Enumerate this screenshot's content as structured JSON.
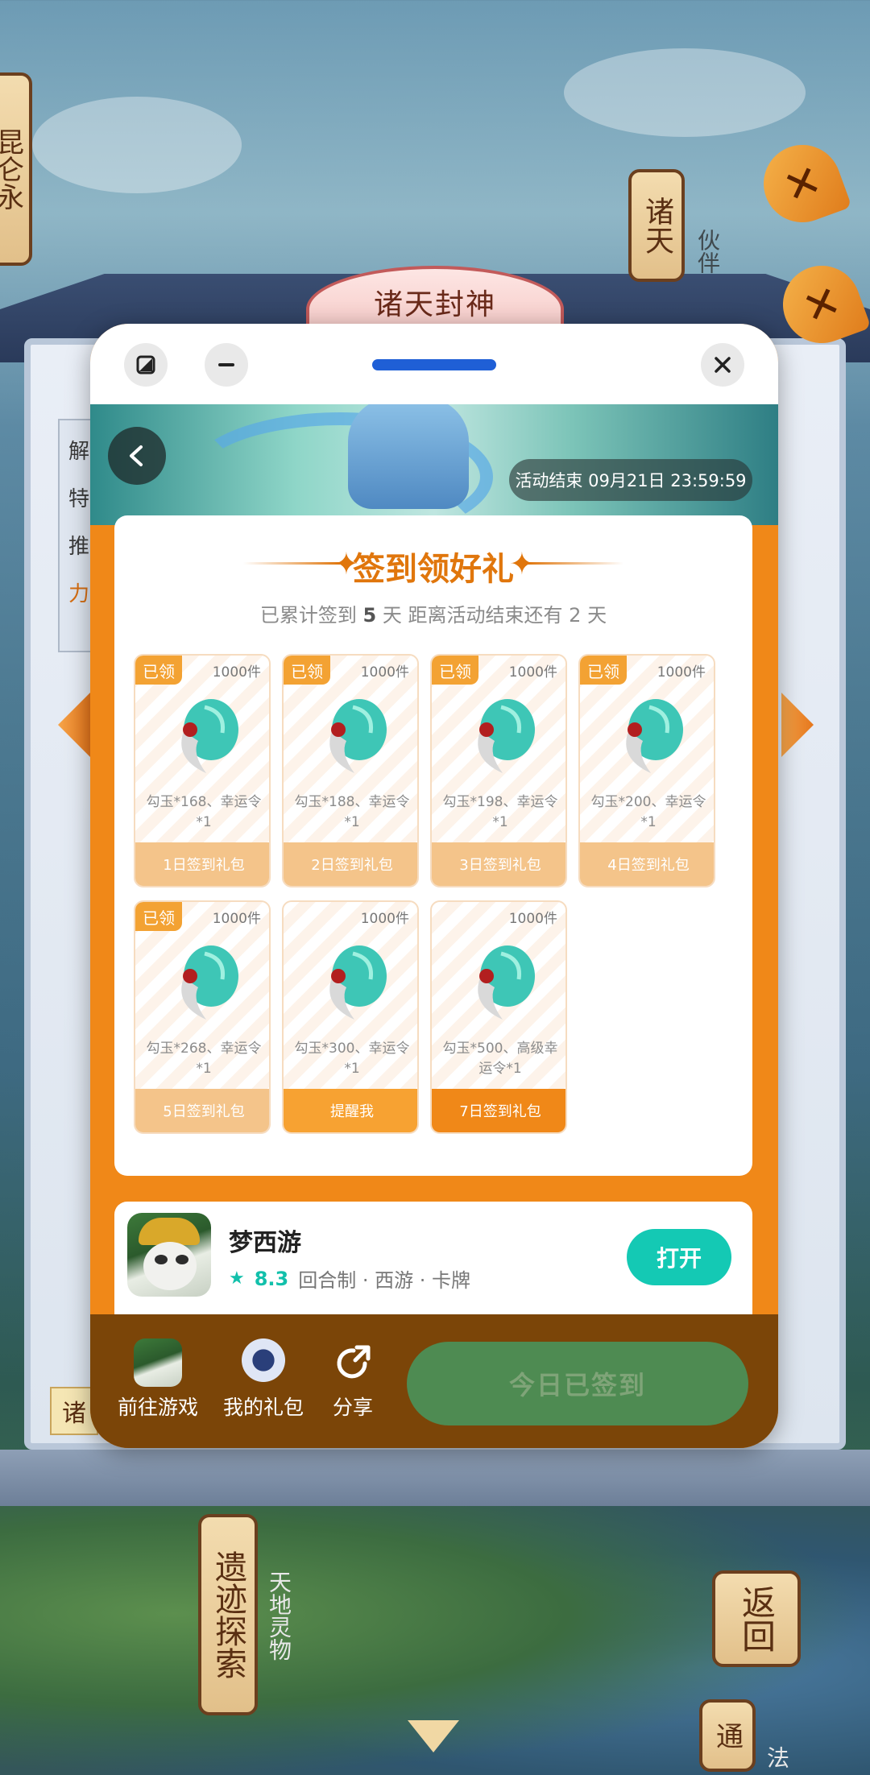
{
  "background": {
    "banner_title": "诸天封神",
    "left_scroll": "昆仑",
    "left_scroll_2": "永",
    "right_scroll": "诸天",
    "right_side_text": "伙伴",
    "left_panel_lines": [
      "解",
      "特",
      "推",
      "力"
    ],
    "left_bottom_label": "诸",
    "bottom_scroll_left": "遗迹探索",
    "bottom_side_text": "天地灵物",
    "bottom_scroll_right": "返回",
    "bottom_scroll_right_2": "通",
    "bottom_right_side_text": "法"
  },
  "modal": {
    "hero": {
      "end_text": "活动结束 09月21日 23:59:59"
    },
    "card": {
      "title": "签到领好礼",
      "subtitle_prefix": "已累计签到",
      "days_signed": "5",
      "subtitle_mid": "天  距离活动结束还有",
      "days_left": "2",
      "subtitle_suffix": "天",
      "gifts": [
        {
          "tag": "已领",
          "qty": "1000件",
          "desc": "勾玉*168、幸运令*1",
          "button": "1日签到礼包",
          "state": "claimed"
        },
        {
          "tag": "已领",
          "qty": "1000件",
          "desc": "勾玉*188、幸运令*1",
          "button": "2日签到礼包",
          "state": "claimed"
        },
        {
          "tag": "已领",
          "qty": "1000件",
          "desc": "勾玉*198、幸运令*1",
          "button": "3日签到礼包",
          "state": "claimed"
        },
        {
          "tag": "已领",
          "qty": "1000件",
          "desc": "勾玉*200、幸运令*1",
          "button": "4日签到礼包",
          "state": "claimed"
        },
        {
          "tag": "已领",
          "qty": "1000件",
          "desc": "勾玉*268、幸运令*1",
          "button": "5日签到礼包",
          "state": "claimed"
        },
        {
          "tag": "",
          "qty": "1000件",
          "desc": "勾玉*300、幸运令*1",
          "button": "提醒我",
          "state": "remind"
        },
        {
          "tag": "",
          "qty": "1000件",
          "desc": "勾玉*500、高级幸运令*1",
          "button": "7日签到礼包",
          "state": "upcoming"
        }
      ]
    },
    "app": {
      "name": "梦西游",
      "rating": "8.3",
      "tags": "回合制 · 西游 · 卡牌",
      "open_button": "打开"
    },
    "bottom_bar": {
      "go_game": "前往游戏",
      "my_gifts": "我的礼包",
      "share": "分享",
      "signed_button": "今日已签到"
    }
  },
  "colors": {
    "accent_orange": "#f08818",
    "teal": "#14c9b4",
    "bottom_brown": "#7b4508",
    "signed_green": "#4e8b52"
  }
}
